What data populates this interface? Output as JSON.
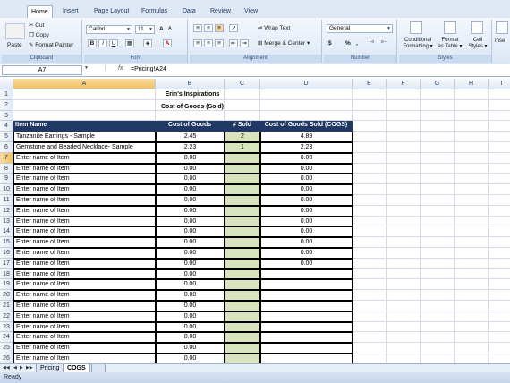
{
  "ribbon": {
    "tabs": [
      "Home",
      "Insert",
      "Page Layout",
      "Formulas",
      "Data",
      "Review",
      "View"
    ],
    "active_tab": "Home",
    "clipboard": {
      "paste": "Paste",
      "cut": "Cut",
      "copy": "Copy",
      "format_painter": "Format Painter",
      "label": "Clipboard"
    },
    "font": {
      "name": "Calibri",
      "size": "11",
      "grow": "A",
      "shrink": "A",
      "bold": "B",
      "italic": "I",
      "underline": "U",
      "label": "Font"
    },
    "alignment": {
      "wrap_text": "Wrap Text",
      "merge_center": "Merge & Center",
      "label": "Alignment"
    },
    "number": {
      "format": "General",
      "currency": "$",
      "percent": "%",
      "comma": ",",
      "label": "Number"
    },
    "styles": {
      "conditional": "Conditional",
      "conditional2": "Formatting",
      "format_table": "Format",
      "format_table2": "as Table",
      "cell_styles": "Cell",
      "cell_styles2": "Styles",
      "label": "Styles"
    },
    "insert": "Inse"
  },
  "formula_bar": {
    "name_box": "A7",
    "fx": "fx",
    "formula": "=Pricing!A24"
  },
  "columns": [
    "A",
    "B",
    "C",
    "D",
    "E",
    "F",
    "G",
    "H",
    "I"
  ],
  "selected_column": "A",
  "selected_row": "7",
  "sheet": {
    "title1": "Erin's Inspirations",
    "title2": "Cost of Goods (Sold)",
    "headers": [
      "Item Name",
      "Cost of Goods",
      "# Sold",
      "Cost of Goods Sold (COGS)"
    ],
    "rows": [
      {
        "num": "5",
        "name": "Tanzanite Earrings - Sample",
        "cost": "2.45",
        "sold": "2",
        "cogs": "4.89"
      },
      {
        "num": "6",
        "name": "Gemstone and Beaded Necklace- Sample",
        "cost": "2.23",
        "sold": "1",
        "cogs": "2.23"
      },
      {
        "num": "7",
        "name": "Enter name of Item",
        "cost": "0.00",
        "sold": "",
        "cogs": "0.00"
      },
      {
        "num": "8",
        "name": "Enter name of Item",
        "cost": "0.00",
        "sold": "",
        "cogs": "0.00"
      },
      {
        "num": "9",
        "name": "Enter name of Item",
        "cost": "0.00",
        "sold": "",
        "cogs": "0.00"
      },
      {
        "num": "10",
        "name": "Enter name of Item",
        "cost": "0.00",
        "sold": "",
        "cogs": "0.00"
      },
      {
        "num": "11",
        "name": "Enter name of Item",
        "cost": "0.00",
        "sold": "",
        "cogs": "0.00"
      },
      {
        "num": "12",
        "name": "Enter name of Item",
        "cost": "0.00",
        "sold": "",
        "cogs": "0.00"
      },
      {
        "num": "13",
        "name": "Enter name of Item",
        "cost": "0.00",
        "sold": "",
        "cogs": "0.00"
      },
      {
        "num": "14",
        "name": "Enter name of Item",
        "cost": "0.00",
        "sold": "",
        "cogs": "0.00"
      },
      {
        "num": "15",
        "name": "Enter name of Item",
        "cost": "0.00",
        "sold": "",
        "cogs": "0.00"
      },
      {
        "num": "16",
        "name": "Enter name of Item",
        "cost": "0.00",
        "sold": "",
        "cogs": "0.00"
      },
      {
        "num": "17",
        "name": "Enter name of Item",
        "cost": "0.00",
        "sold": "",
        "cogs": "0.00"
      },
      {
        "num": "18",
        "name": "Enter name of Item",
        "cost": "0.00",
        "sold": "",
        "cogs": ""
      },
      {
        "num": "19",
        "name": "Enter name of Item",
        "cost": "0.00",
        "sold": "",
        "cogs": ""
      },
      {
        "num": "20",
        "name": "Enter name of Item",
        "cost": "0.00",
        "sold": "",
        "cogs": ""
      },
      {
        "num": "21",
        "name": "Enter name of Item",
        "cost": "0.00",
        "sold": "",
        "cogs": ""
      },
      {
        "num": "22",
        "name": "Enter name of Item",
        "cost": "0.00",
        "sold": "",
        "cogs": ""
      },
      {
        "num": "23",
        "name": "Enter name of Item",
        "cost": "0.00",
        "sold": "",
        "cogs": ""
      },
      {
        "num": "24",
        "name": "Enter name of Item",
        "cost": "0.00",
        "sold": "",
        "cogs": ""
      },
      {
        "num": "25",
        "name": "Enter name of Item",
        "cost": "0.00",
        "sold": "",
        "cogs": ""
      },
      {
        "num": "26",
        "name": "Enter name of Item",
        "cost": "0.00",
        "sold": "",
        "cogs": ""
      }
    ]
  },
  "sheet_tabs": [
    "Pricing",
    "COGS"
  ],
  "active_sheet": "COGS",
  "status": "Ready"
}
